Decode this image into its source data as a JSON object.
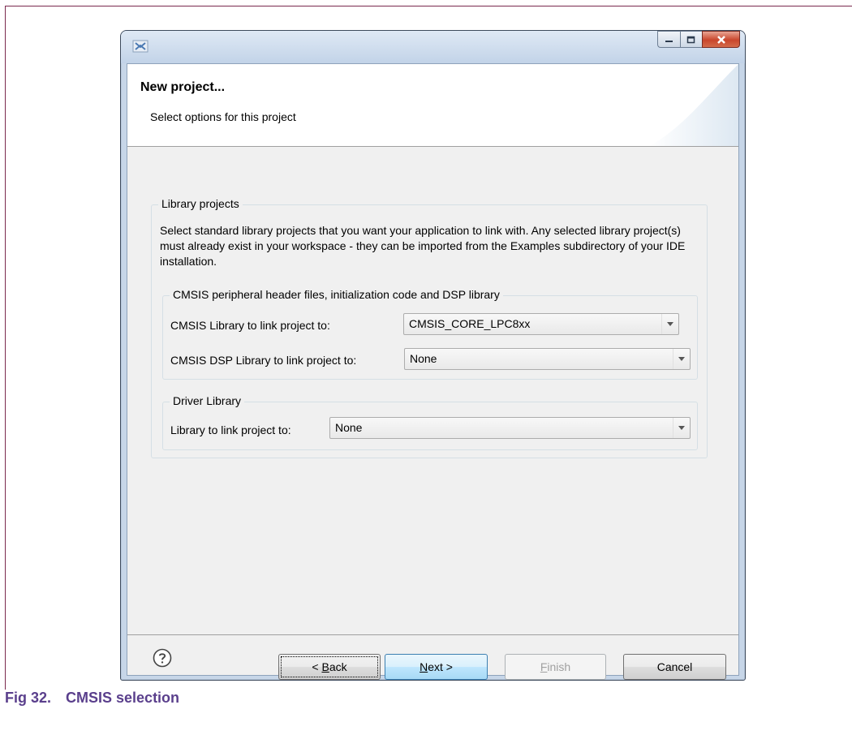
{
  "dialog": {
    "heading": "New project...",
    "description": "Select options for this project",
    "library_projects": {
      "legend": "Library projects",
      "description": "Select standard library projects that you want your application to link with. Any selected library project(s) must already exist in your workspace - they can be imported from the Examples subdirectory of your IDE installation."
    },
    "cmsis": {
      "legend": "CMSIS peripheral header files, initialization code and DSP library",
      "core_label": "CMSIS Library to link project to:",
      "core_value": "CMSIS_CORE_LPC8xx",
      "dsp_label": "CMSIS DSP Library to link project to:",
      "dsp_value": "None"
    },
    "driver": {
      "legend": "Driver Library",
      "label": "Library to link project to:",
      "value": "None"
    },
    "buttons": {
      "back_pre": "< ",
      "back_u": "B",
      "back_post": "ack",
      "next_u": "N",
      "next_post": "ext >",
      "finish_u": "F",
      "finish_post": "inish",
      "cancel": "Cancel"
    }
  },
  "caption": {
    "number": "Fig 32.",
    "title": "CMSIS selection"
  },
  "icons": [
    "app-icon",
    "minimize-icon",
    "maximize-icon",
    "close-icon",
    "help-icon",
    "dropdown-arrow-icon"
  ]
}
